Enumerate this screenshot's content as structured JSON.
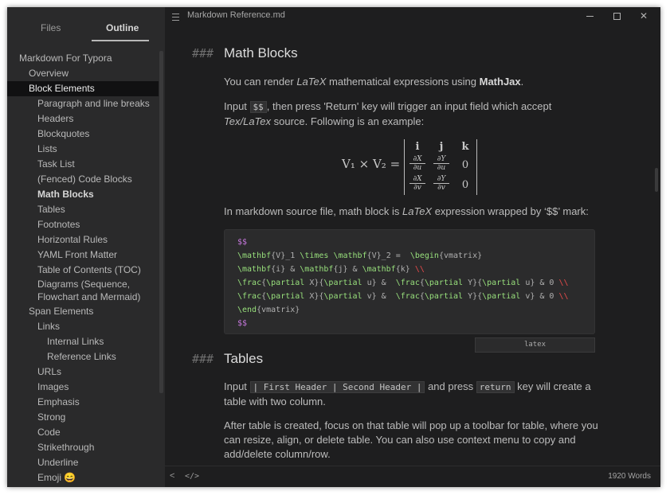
{
  "window": {
    "title": "Markdown Reference.md"
  },
  "sidebar": {
    "tabs": {
      "files": "Files",
      "outline": "Outline"
    },
    "outline": [
      {
        "label": "Markdown For Typora",
        "level": 0
      },
      {
        "label": "Overview",
        "level": 1
      },
      {
        "label": "Block Elements",
        "level": 1,
        "active": true
      },
      {
        "label": "Paragraph and line breaks",
        "level": 2
      },
      {
        "label": "Headers",
        "level": 2
      },
      {
        "label": "Blockquotes",
        "level": 2
      },
      {
        "label": "Lists",
        "level": 2
      },
      {
        "label": "Task List",
        "level": 2
      },
      {
        "label": "(Fenced) Code Blocks",
        "level": 2
      },
      {
        "label": "Math Blocks",
        "level": 2,
        "bold": true
      },
      {
        "label": "Tables",
        "level": 2
      },
      {
        "label": "Footnotes",
        "level": 2
      },
      {
        "label": "Horizontal Rules",
        "level": 2
      },
      {
        "label": "YAML Front Matter",
        "level": 2
      },
      {
        "label": "Table of Contents (TOC)",
        "level": 2
      },
      {
        "label": "Diagrams (Sequence, Flowchart and Mermaid)",
        "level": 2,
        "two_line": true
      },
      {
        "label": "Span Elements",
        "level": 1
      },
      {
        "label": "Links",
        "level": 2
      },
      {
        "label": "Internal Links",
        "level": 3
      },
      {
        "label": "Reference Links",
        "level": 3
      },
      {
        "label": "URLs",
        "level": 2
      },
      {
        "label": "Images",
        "level": 2
      },
      {
        "label": "Emphasis",
        "level": 2
      },
      {
        "label": "Strong",
        "level": 2
      },
      {
        "label": "Code",
        "level": 2
      },
      {
        "label": "Strikethrough",
        "level": 2
      },
      {
        "label": "Underline",
        "level": 2
      },
      {
        "label": "Emoji 😄",
        "level": 2
      }
    ]
  },
  "editor": {
    "section1": {
      "mark": "###",
      "heading": "Math Blocks",
      "p1_a": "You can render ",
      "p1_latex": "LaTeX",
      "p1_b": " mathematical expressions using ",
      "p1_mathjax": "MathJax",
      "p1_c": ".",
      "p2_a": "Input ",
      "p2_code": "$$",
      "p2_b": ", then press 'Return' key will trigger an input field which accept ",
      "p2_tex": "Tex/LaTex",
      "p2_c": " source. Following is an example:",
      "math": {
        "lhs": "V₁ × V₂ =",
        "row1": [
          "i",
          "j",
          "k"
        ],
        "row2": [
          {
            "num": "∂X",
            "den": "∂u"
          },
          {
            "num": "∂Y",
            "den": "∂u"
          },
          "0"
        ],
        "row3": [
          {
            "num": "∂X",
            "den": "∂v"
          },
          {
            "num": "∂Y",
            "den": "∂v"
          },
          "0"
        ]
      },
      "p3_a": "In markdown source file, math block is ",
      "p3_latex": "LaTeX",
      "p3_b": " expression wrapped by ‘$$’ mark:",
      "code_lines": [
        "$$",
        "\\mathbf{V}_1 \\times \\mathbf{V}_2 =  \\begin{vmatrix}",
        "\\mathbf{i} & \\mathbf{j} & \\mathbf{k} \\\\",
        "\\frac{\\partial X}{\\partial u} &  \\frac{\\partial Y}{\\partial u} & 0 \\\\",
        "\\frac{\\partial X}{\\partial v} &  \\frac{\\partial Y}{\\partial v} & 0 \\\\",
        "\\end{vmatrix}",
        "$$"
      ],
      "code_lang": "latex"
    },
    "section2": {
      "mark": "###",
      "heading": "Tables",
      "p1_a": "Input ",
      "p1_code": "| First Header  | Second Header |",
      "p1_b": " and press ",
      "p1_code2": "return",
      "p1_c": " key will create a table with two column.",
      "p2": "After table is created, focus on that table will pop up a toolbar for table, where you can resize, align, or delete table. You can also use context menu to copy and add/delete column/row."
    }
  },
  "statusbar": {
    "left_icon": "<",
    "code_icon": "</>",
    "words": "1920 Words"
  }
}
